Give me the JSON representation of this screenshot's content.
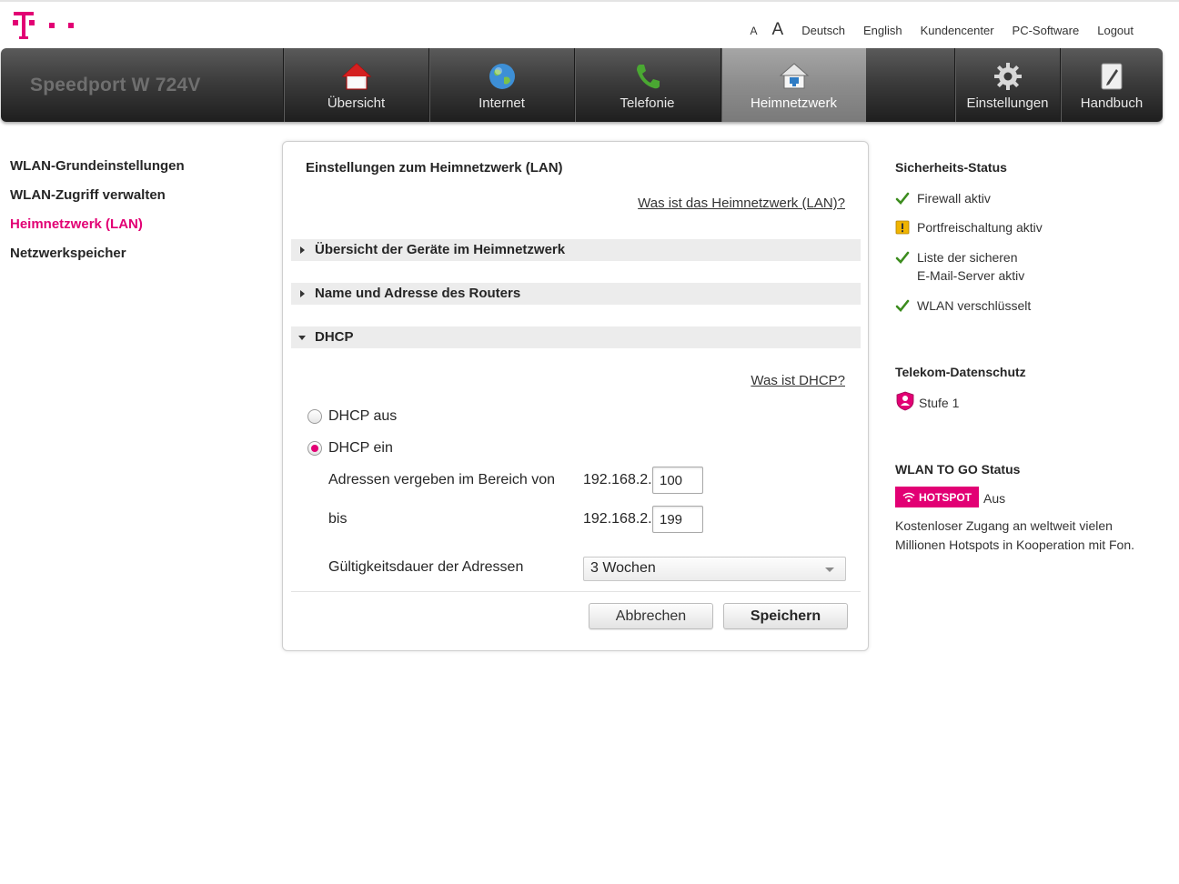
{
  "colors": {
    "magenta": "#e20074",
    "check_green": "#3c8c1e",
    "warning_yellow": "#f0b400"
  },
  "top_links": {
    "font_small": "A",
    "font_large": "A",
    "deutsch": "Deutsch",
    "english": "English",
    "kundencenter": "Kundencenter",
    "pc_software": "PC-Software",
    "logout": "Logout"
  },
  "nav": {
    "brand": "Speedport W 724V",
    "items": [
      {
        "label": "Übersicht",
        "icon": "home-icon"
      },
      {
        "label": "Internet",
        "icon": "globe-icon"
      },
      {
        "label": "Telefonie",
        "icon": "phone-icon"
      },
      {
        "label": "Heimnetzwerk",
        "icon": "home-network-icon"
      },
      {
        "label": "Einstellungen",
        "icon": "gear-icon"
      },
      {
        "label": "Handbuch",
        "icon": "manual-icon"
      }
    ]
  },
  "sidebar": {
    "items": [
      {
        "label": "WLAN-Grundeinstellungen"
      },
      {
        "label": "WLAN-Zugriff verwalten"
      },
      {
        "label": "Heimnetzwerk (LAN)"
      },
      {
        "label": "Netzwerkspeicher"
      }
    ]
  },
  "main": {
    "title": "Einstellungen zum Heimnetzwerk (LAN)",
    "help_lan": "Was ist das Heimnetzwerk (LAN)?",
    "sections": [
      {
        "label": "Übersicht der Geräte im Heimnetzwerk"
      },
      {
        "label": "Name und Adresse des Routers"
      },
      {
        "label": "DHCP"
      }
    ],
    "help_dhcp": "Was ist DHCP?",
    "dhcp_off": "DHCP aus",
    "dhcp_on": "DHCP ein",
    "range_label": "Adressen vergeben im Bereich von",
    "range_to_label": "bis",
    "ip_prefix": "192.168.2.",
    "range_from": "100",
    "range_to": "199",
    "lease_label": "Gültigkeitsdauer der Adressen",
    "lease_value": "3 Wochen",
    "cancel": "Abbrechen",
    "save": "Speichern"
  },
  "right": {
    "security_title": "Sicherheits-Status",
    "firewall": "Firewall aktiv",
    "portforward": "Portfreischaltung aktiv",
    "safe_mail_1": "Liste der sicheren",
    "safe_mail_2": "E-Mail-Server aktiv",
    "wlan_enc": "WLAN verschlüsselt",
    "privacy_title": "Telekom-Datenschutz",
    "privacy_level": "Stufe 1",
    "wlan_to_go_title": "WLAN TO GO Status",
    "hotspot_badge": "HOTSPOT",
    "hotspot_state": "Aus",
    "hotspot_desc_1": "Kostenloser Zugang an weltweit vielen",
    "hotspot_desc_2": "Millionen Hotspots in Kooperation mit Fon."
  }
}
